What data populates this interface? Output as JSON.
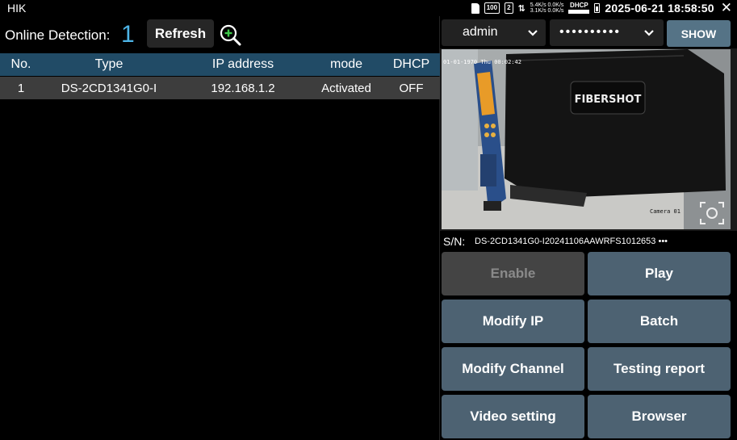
{
  "statusbar": {
    "app_title": "HIK",
    "storage_badge": "100",
    "screen_badge": "2",
    "net_up": "5.4K/s 0.0K/s",
    "net_down": "3.1K/s 0.0K/s",
    "dhcp_label": "DHCP",
    "datetime": "2025-06-21 18:58:50"
  },
  "detection": {
    "label": "Online Detection:",
    "count": "1",
    "refresh_label": "Refresh"
  },
  "table": {
    "columns": [
      "No.",
      "Type",
      "IP address",
      "mode",
      "DHCP"
    ],
    "rows": [
      {
        "no": "1",
        "type": "DS-2CD1341G0-I",
        "ip": "192.168.1.2",
        "mode": "Activated",
        "dhcp": "OFF"
      }
    ]
  },
  "credentials": {
    "username": "admin",
    "password_mask": "••••••••••",
    "show_label": "SHOW"
  },
  "video": {
    "osd_time": "01-01-1970 Thu 00:02:42",
    "osd_channel": "Camera 01",
    "brand_text": "FIBERSHOT"
  },
  "serial": {
    "label": "S/N:",
    "value": "DS-2CD1341G0-I20241106AAWRFS1012653 •••"
  },
  "actions": {
    "enable": "Enable",
    "play": "Play",
    "modify_ip": "Modify IP",
    "batch": "Batch",
    "modify_channel": "Modify Channel",
    "testing_report": "Testing report",
    "video_setting": "Video setting",
    "browser": "Browser"
  },
  "colors": {
    "accent_count": "#4db4e6",
    "table_header": "#214b66",
    "action_button": "#4d6272",
    "show_button": "#557386"
  }
}
